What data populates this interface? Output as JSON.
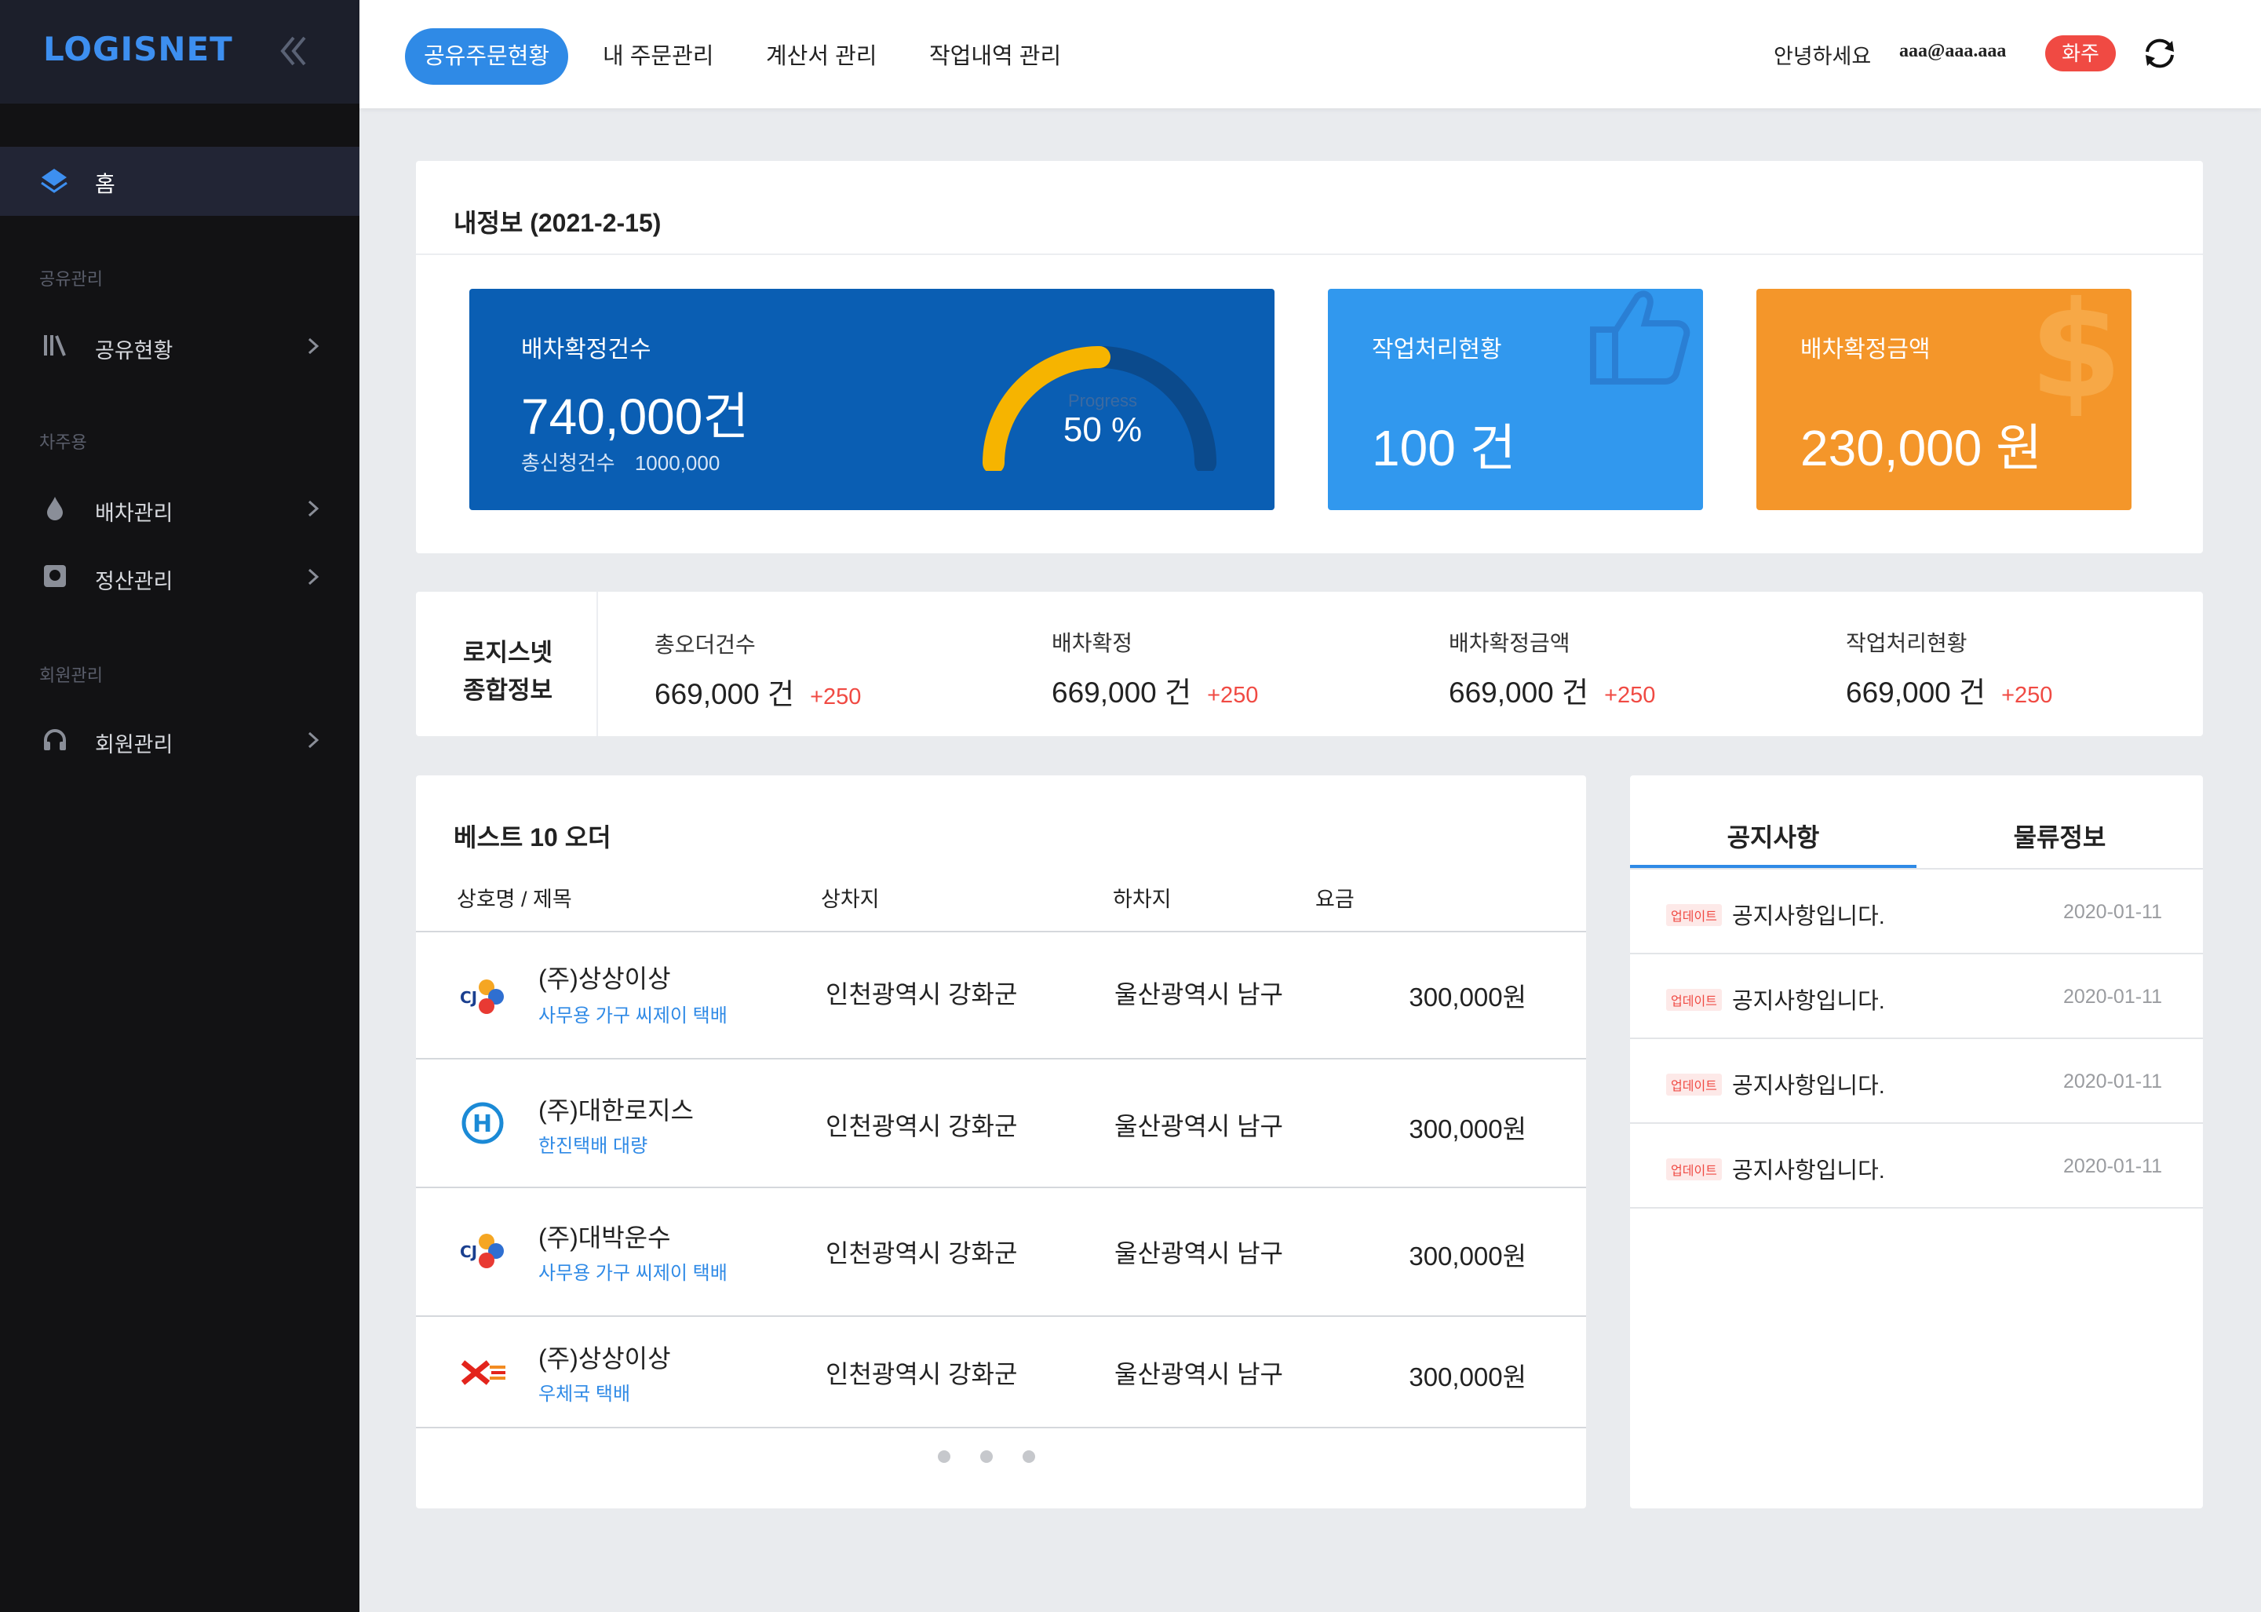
{
  "sidebar": {
    "logo": "LOGISNET",
    "home": "홈",
    "sections": [
      "공유관리",
      "차주용",
      "회원관리"
    ],
    "items": [
      {
        "label": "공유현황"
      },
      {
        "label": "배차관리"
      },
      {
        "label": "정산관리"
      },
      {
        "label": "회원관리"
      }
    ]
  },
  "topbar": {
    "tabs": [
      "공유주문현황",
      "내 주문관리",
      "계산서 관리",
      "작업내역 관리"
    ],
    "greeting": "안녕하세요",
    "email": "aaa@aaa.aaa",
    "role": "화주"
  },
  "info": {
    "title": "내정보 (2021-2-15)",
    "dispatch": {
      "title": "배차확정건수",
      "value": "740,000건",
      "sub_label": "총신청건수",
      "sub_value": "1000,000",
      "progress_label": "Progress",
      "progress_value": "50 %",
      "progress": 0.5
    },
    "work": {
      "title": "작업처리현황",
      "value": "100 건"
    },
    "amount": {
      "title": "배차확정금액",
      "value": "230,000 원"
    }
  },
  "summary": {
    "title_line1": "로지스넷",
    "title_line2": "종합정보",
    "columns": [
      {
        "label": "총오더건수",
        "value": "669,000 건",
        "delta": "+250"
      },
      {
        "label": "배차확정",
        "value": "669,000 건",
        "delta": "+250"
      },
      {
        "label": "배차확정금액",
        "value": "669,000 건",
        "delta": "+250"
      },
      {
        "label": "작업처리현황",
        "value": "669,000 건",
        "delta": "+250"
      }
    ]
  },
  "best": {
    "title": "베스트 10 오더",
    "headers": [
      "상호명 / 제목",
      "상차지",
      "하차지",
      "요금"
    ],
    "rows": [
      {
        "logo": "cj-logo-icon",
        "company": "(주)상상이상",
        "desc": "사무용 가구 씨제이 택배",
        "from": "인천광역시 강화군",
        "to": "울산광역시 남구",
        "fee": "300,000원"
      },
      {
        "logo": "hanjin-logo-icon",
        "company": "(주)대한로지스",
        "desc": "한진택배 대량",
        "from": "인천광역시 강화군",
        "to": "울산광역시 남구",
        "fee": "300,000원"
      },
      {
        "logo": "cj-logo-icon",
        "company": "(주)대박운수",
        "desc": "사무용 가구 씨제이 택배",
        "from": "인천광역시 강화군",
        "to": "울산광역시 남구",
        "fee": "300,000원"
      },
      {
        "logo": "post-logo-icon",
        "company": "(주)상상이상",
        "desc": "우체국 택배",
        "from": "인천광역시 강화군",
        "to": "울산광역시 남구",
        "fee": "300,000원"
      }
    ]
  },
  "notice": {
    "tabs": [
      "공지사항",
      "물류정보"
    ],
    "items": [
      {
        "badge": "업데이트",
        "text": "공지사항입니다.",
        "date": "2020-01-11"
      },
      {
        "badge": "업데이트",
        "text": "공지사항입니다.",
        "date": "2020-01-11"
      },
      {
        "badge": "업데이트",
        "text": "공지사항입니다.",
        "date": "2020-01-11"
      },
      {
        "badge": "업데이트",
        "text": "공지사항입니다.",
        "date": "2020-01-11"
      }
    ]
  },
  "colors": {
    "accent": "#2f8ae6",
    "sidebar_bg": "#121214",
    "dispatch_card": "#0a5eb3",
    "work_card": "#3198ee",
    "amount_card": "#f4962a",
    "gauge": "#f6b400",
    "delta": "#f04a43"
  }
}
